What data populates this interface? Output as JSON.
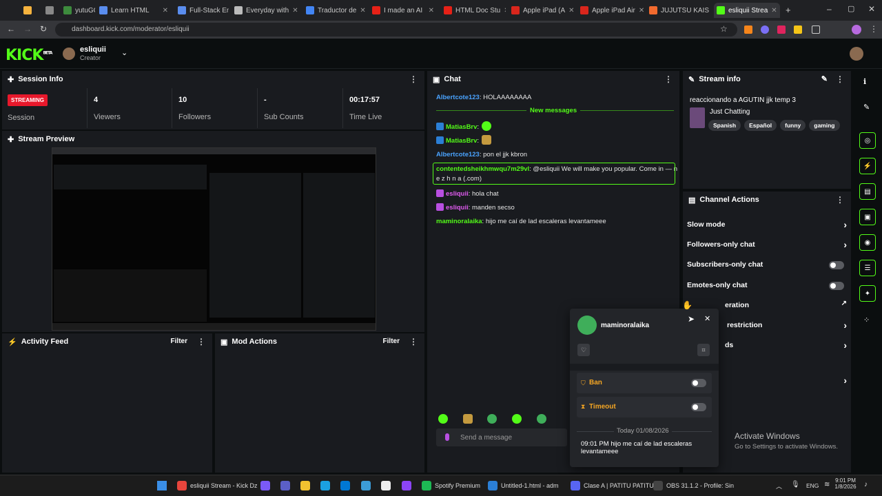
{
  "browser": {
    "tabs": [
      {
        "label": "",
        "fav": "#f6b33e"
      },
      {
        "label": "",
        "fav": "#888"
      },
      {
        "label": "yutuGOAT",
        "fav": "#3d8b3d"
      },
      {
        "label": "Learn HTML",
        "fav": "#5a8dee"
      },
      {
        "label": "Full-Stack Eng",
        "fav": "#5a8dee"
      },
      {
        "label": "Everyday with",
        "fav": "#bbb"
      },
      {
        "label": "Traductor de",
        "fav": "#4285f4"
      },
      {
        "label": "I made an AI",
        "fav": "#e62117"
      },
      {
        "label": "HTML Doc Stu",
        "fav": "#e62117"
      },
      {
        "label": "Apple iPad (A",
        "fav": "#d9261c"
      },
      {
        "label": "Apple iPad Air",
        "fav": "#d9261c"
      },
      {
        "label": "JUJUTSU KAIS",
        "fav": "#f26a2e"
      },
      {
        "label": "esliquii Strea",
        "fav": "#53fc18"
      }
    ],
    "url": "dashboard.kick.com/moderator/esliquii"
  },
  "header": {
    "logo": "KICK",
    "beta": "BETA",
    "username": "esliquii",
    "role": "Creator"
  },
  "session": {
    "title": "Session Info",
    "status": "STREAMING",
    "session_label": "Session",
    "stats": [
      {
        "value": "4",
        "label": "Viewers"
      },
      {
        "value": "10",
        "label": "Followers"
      },
      {
        "value": "-",
        "label": "Sub Counts"
      },
      {
        "value": "00:17:57",
        "label": "Time Live"
      }
    ]
  },
  "preview": {
    "title": "Stream Preview"
  },
  "activity": {
    "title": "Activity Feed",
    "filter": "Filter"
  },
  "mod": {
    "title": "Mod Actions",
    "filter": "Filter"
  },
  "chat": {
    "title": "Chat",
    "new_messages": "New messages",
    "messages": [
      {
        "user": "Albertcote123",
        "text": ": HOLAAAAAAAA",
        "color": "#4aa3ff"
      },
      {
        "user": "MatiasBrv",
        "text": ":",
        "color": "#53fc18"
      },
      {
        "user": "MatiasBrv",
        "text": ":",
        "color": "#53fc18"
      },
      {
        "user": "Albertcote123",
        "text": ": pon el jjk kbron",
        "color": "#4aa3ff"
      },
      {
        "user": "contentedsheikhmwqu7m29vl",
        "text": ": @esliquii We will make you popular. Come in — n",
        "text2": "e z h n a (.com)",
        "color": "#53fc18"
      },
      {
        "user": "esliquii",
        "text": ": hola chat",
        "color": "#e05bf0"
      },
      {
        "user": "esliquii",
        "text": ": manden secso",
        "color": "#e05bf0"
      },
      {
        "user": "maminoralaika",
        "text": ": hijo me caí de lad escaleras levantameee",
        "color": "#53fc18"
      }
    ],
    "send_placeholder": "Send a message"
  },
  "streaminfo": {
    "title": "Stream info",
    "stream_title": "reaccionando a AGUTIN jjk temp 3",
    "category": "Just Chatting",
    "tags": [
      "Spanish",
      "Español",
      "funny",
      "gaming"
    ]
  },
  "channel_actions": {
    "title": "Channel Actions",
    "items": [
      "Slow mode",
      "Followers-only chat",
      "Subscribers-only chat",
      "Emotes-only chat",
      "eration",
      "restriction",
      "ds"
    ]
  },
  "usercard": {
    "username": "maminoralaika",
    "ban": "Ban",
    "timeout": "Timeout",
    "date": "Today 01/08/2026",
    "time": "09:01 PM",
    "message": "hijo me caí de lad escaleras levantameee"
  },
  "watermark": {
    "line1": "Activate Windows",
    "line2": "Go to Settings to activate Windows."
  },
  "taskbar": {
    "apps": [
      {
        "label": "esliquii Stream - Kick Dz",
        "color": "#e8453c"
      },
      {
        "label": "",
        "color": "#7a5af8"
      },
      {
        "label": "",
        "color": "#5b5fc7"
      },
      {
        "label": "",
        "color": "#f2c230"
      },
      {
        "label": "",
        "color": "#1ba1e2"
      },
      {
        "label": "",
        "color": "#0078d4"
      },
      {
        "label": "",
        "color": "#3c9cd7"
      },
      {
        "label": "",
        "color": "#eee"
      },
      {
        "label": "",
        "color": "#8c44f7"
      },
      {
        "label": "Spotify Premium",
        "color": "#1db954"
      },
      {
        "label": "Untitled-1.html - adm",
        "color": "#2b7fd6"
      },
      {
        "label": "Clase A | PATITU PATITU",
        "color": "#5865f2"
      },
      {
        "label": "OBS 31.1.2 - Profile: Sin",
        "color": "#444"
      }
    ],
    "lang": "ENG",
    "time": "9:01 PM",
    "date": "1/8/2026"
  }
}
